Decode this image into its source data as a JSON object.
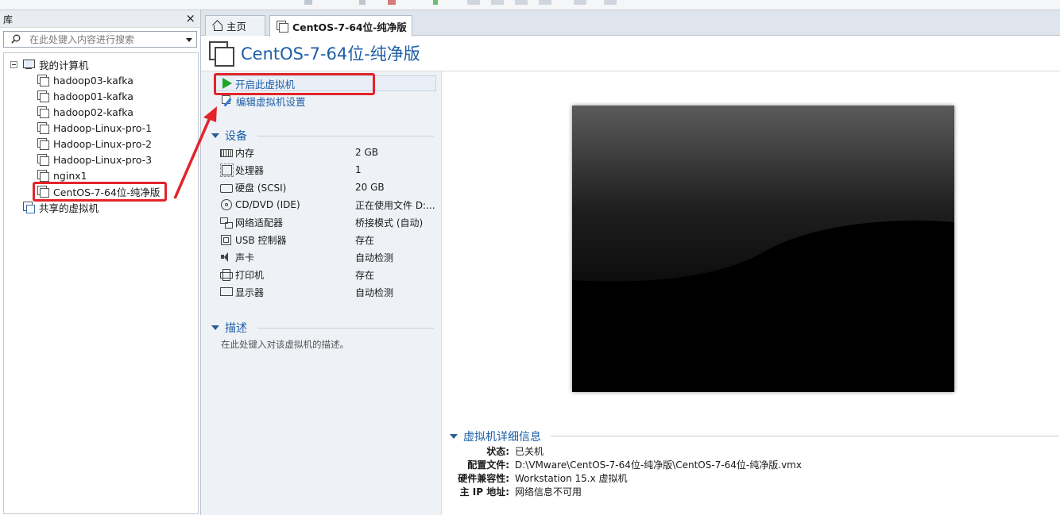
{
  "library": {
    "title": "库",
    "close_label": "×",
    "search_placeholder": "在此处键入内容进行搜索",
    "my_computer": "我的计算机",
    "vms": [
      "hadoop03-kafka",
      "hadoop01-kafka",
      "hadoop02-kafka",
      "Hadoop-Linux-pro-1",
      "Hadoop-Linux-pro-2",
      "Hadoop-Linux-pro-3",
      "nginx1",
      "CentOS-7-64位-纯净版"
    ],
    "shared": "共享的虚拟机"
  },
  "tabs": [
    {
      "label": "主页",
      "icon": "home-icon"
    },
    {
      "label": "CentOS-7-64位-纯净版",
      "icon": "vm-icon",
      "close": "×"
    }
  ],
  "vm": {
    "name": "CentOS-7-64位-纯净版",
    "actions": {
      "start": "开启此虚拟机",
      "edit": "编辑虚拟机设置"
    },
    "devices_title": "设备",
    "devices": [
      {
        "icon": "memory-icon",
        "name": "内存",
        "value": "2 GB"
      },
      {
        "icon": "cpu-icon",
        "name": "处理器",
        "value": "1"
      },
      {
        "icon": "harddisk-icon",
        "name": "硬盘 (SCSI)",
        "value": "20 GB"
      },
      {
        "icon": "cdrom-icon",
        "name": "CD/DVD (IDE)",
        "value": "正在使用文件 D:..."
      },
      {
        "icon": "network-icon",
        "name": "网络适配器",
        "value": "桥接模式 (自动)"
      },
      {
        "icon": "usb-icon",
        "name": "USB 控制器",
        "value": "存在"
      },
      {
        "icon": "sound-icon",
        "name": "声卡",
        "value": "自动检测"
      },
      {
        "icon": "printer-icon",
        "name": "打印机",
        "value": "存在"
      },
      {
        "icon": "monitor-icon",
        "name": "显示器",
        "value": "自动检测"
      }
    ],
    "description_title": "描述",
    "description_placeholder": "在此处键入对该虚拟机的描述。",
    "details_title": "虚拟机详细信息",
    "details": [
      {
        "key": "状态:",
        "value": "已关机"
      },
      {
        "key": "配置文件:",
        "value": "D:\\VMware\\CentOS-7-64位-纯净版\\CentOS-7-64位-纯净版.vmx"
      },
      {
        "key": "硬件兼容性:",
        "value": "Workstation 15.x 虚拟机"
      },
      {
        "key": "主 IP 地址:",
        "value": "网络信息不可用"
      }
    ]
  },
  "colors": {
    "accent": "#1d5ea8",
    "annotation": "#e3242b",
    "play": "#22a52a"
  }
}
